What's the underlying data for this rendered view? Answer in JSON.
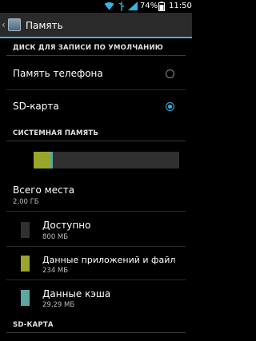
{
  "status_bar": {
    "wifi_icon": "wifi-icon",
    "usb_icon": "usb-icon",
    "battery_percent": "74%",
    "time": "11:50"
  },
  "action_bar": {
    "title": "Память",
    "back_icon": "back-chevron-icon",
    "app_icon": "storage-settings-icon"
  },
  "default_disk": {
    "header": "ДИСК ДЛЯ ЗАПИСИ ПО УМОЛЧАНИЮ",
    "options": [
      {
        "label": "Память телефона",
        "checked": false
      },
      {
        "label": "SD-карта",
        "checked": true
      }
    ]
  },
  "system_memory": {
    "header": "СИСТЕМНАЯ ПАМЯТЬ",
    "usage": [
      {
        "name": "Данные приложений и файлы",
        "fraction": 0.117,
        "color": "#9aa62a"
      },
      {
        "name": "Данные кэша",
        "fraction": 0.015,
        "color": "#5aa8a0"
      },
      {
        "name": "Доступно",
        "fraction": 0.868,
        "color": "#303030"
      }
    ],
    "total": {
      "label": "Всего места",
      "value": "2,00 ГБ"
    },
    "items": [
      {
        "label": "Доступно",
        "value": "800 МБ",
        "color": "#303030"
      },
      {
        "label": "Данные приложений и файл",
        "value": "234 МБ",
        "color": "#9aa62a"
      },
      {
        "label": "Данные кэша",
        "value": "29,29 МБ",
        "color": "#5aa8a0"
      }
    ]
  },
  "sd_card": {
    "header": "SD-КАРТА"
  }
}
